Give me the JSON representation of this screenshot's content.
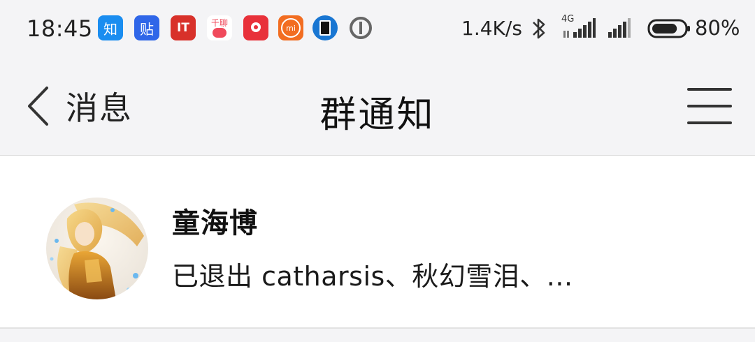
{
  "status_bar": {
    "time": "18:45",
    "net_speed": "1.4K/s",
    "network_type": "4G",
    "battery_percent": "80%",
    "battery_level": 0.8,
    "apps": [
      {
        "icon": "zhihu-icon",
        "text": "知",
        "color": "#1a8df0"
      },
      {
        "icon": "tieba-icon",
        "text": "贴",
        "color": "#2f66e8"
      },
      {
        "icon": "ithome-icon",
        "text": "IT",
        "color": "#d8312a"
      },
      {
        "icon": "qianliao-icon",
        "text": "千聊",
        "color": "#f04a5c"
      },
      {
        "icon": "red-app-icon",
        "text": "",
        "color": "#e8313a"
      },
      {
        "icon": "mi-icon",
        "text": "mi",
        "color": "#f26d21"
      },
      {
        "icon": "phone-manager-icon",
        "text": "",
        "color": "#1976d2"
      },
      {
        "icon": "circle-app-icon",
        "text": "",
        "color": "#666666"
      }
    ]
  },
  "header": {
    "back_label": "消息",
    "title": "群通知"
  },
  "notifications": [
    {
      "name": "童海博",
      "message": "已退出 catharsis、秋幻雪泪、..."
    }
  ]
}
